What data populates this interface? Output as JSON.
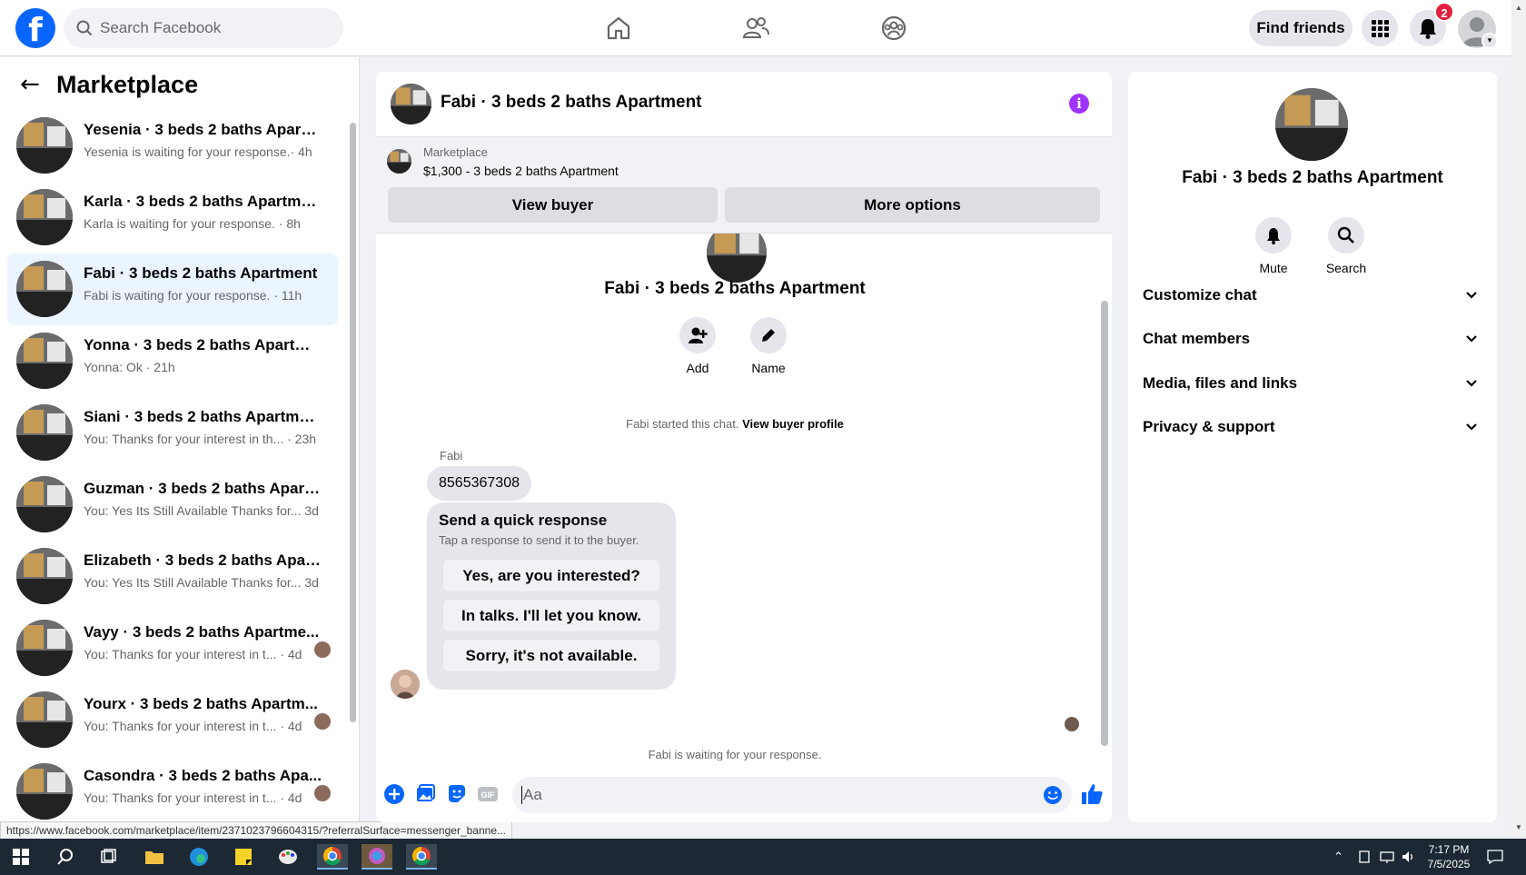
{
  "topbar": {
    "search_placeholder": "Search Facebook",
    "find_friends": "Find friends",
    "notif_count": "2",
    "logo_letter": "f"
  },
  "sidebar": {
    "title": "Marketplace",
    "conversations": [
      {
        "name": "Yesenia · 3 beds 2 baths Apartm...",
        "sub": "Yesenia is waiting for your response.· 4h"
      },
      {
        "name": "Karla · 3 beds 2 baths Apartment",
        "sub": "Karla is waiting for your response. · 8h"
      },
      {
        "name": "Fabi · 3 beds 2 baths Apartment",
        "sub": "Fabi is waiting for your response. · 11h"
      },
      {
        "name": "Yonna · 3 beds 2 baths Apartment",
        "sub": "Yonna: Ok · 21h"
      },
      {
        "name": "Siani · 3 beds 2 baths Apartment",
        "sub": "You: Thanks for your interest in th...  · 23h"
      },
      {
        "name": "Guzman · 3 beds 2 baths Apart...",
        "sub": "You: Yes Its Still Available Thanks for... 3d"
      },
      {
        "name": "Elizabeth · 3 beds 2 baths Apart...",
        "sub": "You: Yes Its Still Available Thanks for... 3d"
      },
      {
        "name": "Vayy · 3 beds 2 baths Apartme...",
        "sub": "You: Thanks for your interest in t... · 4d"
      },
      {
        "name": "Yourx · 3 beds 2 baths Apartm...",
        "sub": "You: Thanks for your interest in t... · 4d"
      },
      {
        "name": "Casondra · 3 beds 2 baths Apa...",
        "sub": "You: Thanks for your interest in t... · 4d"
      }
    ]
  },
  "status_url": "https://www.facebook.com/marketplace/item/2371023796604315/?referralSurface=messenger_banne...",
  "chat": {
    "title": "Fabi · 3 beds 2 baths Apartment",
    "info_glyph": "i",
    "marketplace_label": "Marketplace",
    "listing": "$1,300 - 3 beds 2 baths Apartment",
    "view_buyer": "View buyer",
    "more_options": "More options",
    "center_title": "Fabi · 3 beds 2 baths Apartment",
    "add_label": "Add",
    "name_label": "Name",
    "started_text": "Fabi started this chat. ",
    "view_buyer_profile": "View buyer profile",
    "sender": "Fabi",
    "message": "8565367308",
    "quick_title": "Send a quick response",
    "quick_sub": "Tap a response to send it to the buyer.",
    "quick_options": [
      "Yes, are you interested?",
      "In talks. I'll let you know.",
      "Sorry, it's not available."
    ],
    "waiting": "Fabi is waiting for your response.",
    "composer_placeholder": "Aa"
  },
  "right_panel": {
    "title": "Fabi · 3 beds 2 baths Apartment",
    "mute": "Mute",
    "search": "Search",
    "sections": [
      "Customize chat",
      "Chat members",
      "Media, files and links",
      "Privacy & support"
    ]
  },
  "taskbar": {
    "time": "7:17 PM",
    "date": "7/5/2025"
  },
  "colors": {
    "brand": "#0866ff",
    "info": "#a033ff",
    "notif": "#e41e3f",
    "active_row": "#ebf5ff"
  }
}
